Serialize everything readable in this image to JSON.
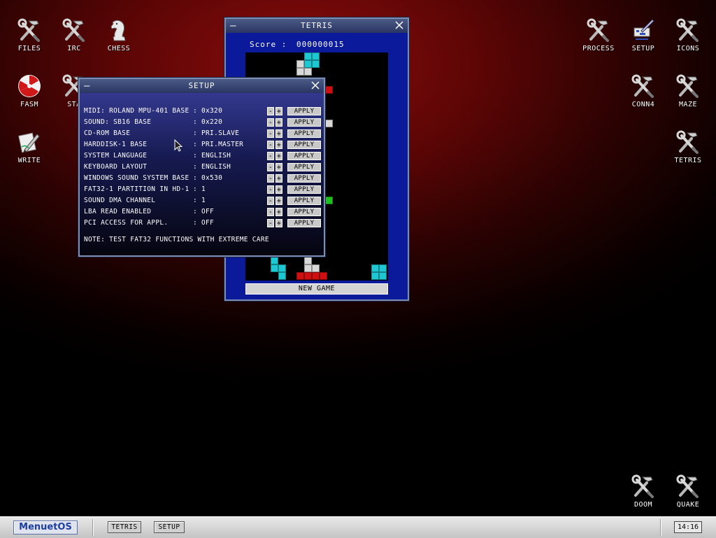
{
  "desktop": {
    "icons": [
      {
        "label": "FILES",
        "icon": "tools-icon"
      },
      {
        "label": "IRC",
        "icon": "tools-icon"
      },
      {
        "label": "CHESS",
        "icon": "chess-knight-icon"
      },
      {
        "label": "FASM",
        "icon": "radiation-icon"
      },
      {
        "label": "STA",
        "icon": "tools-icon"
      },
      {
        "label": "WRITE",
        "icon": "pen-icon"
      },
      {
        "label": "PROCESS",
        "icon": "tools-icon"
      },
      {
        "label": "SETUP",
        "icon": "setup-icon"
      },
      {
        "label": "ICONS",
        "icon": "tools-icon"
      },
      {
        "label": "CONN4",
        "icon": "tools-icon"
      },
      {
        "label": "MAZE",
        "icon": "tools-icon"
      },
      {
        "label": "TETRIS",
        "icon": "tools-icon"
      },
      {
        "label": "DOOM",
        "icon": "tools-icon"
      },
      {
        "label": "QUAKE",
        "icon": "tools-icon"
      }
    ]
  },
  "tetris": {
    "title": "TETRIS",
    "score_label": "Score :",
    "score_value": "000000015",
    "new_game": "NEW GAME"
  },
  "setup": {
    "title": "SETUP",
    "rows": [
      {
        "name": "MIDI: ROLAND MPU-401 BASE",
        "value": "0x320"
      },
      {
        "name": "SOUND: SB16 BASE",
        "value": "0x220"
      },
      {
        "name": "CD-ROM BASE",
        "value": "PRI.SLAVE"
      },
      {
        "name": "HARDDISK-1 BASE",
        "value": "PRI.MASTER"
      },
      {
        "name": "SYSTEM LANGUAGE",
        "value": "ENGLISH"
      },
      {
        "name": "KEYBOARD LAYOUT",
        "value": "ENGLISH"
      },
      {
        "name": "WINDOWS SOUND SYSTEM BASE",
        "value": "0x530"
      },
      {
        "name": "FAT32-1 PARTITION IN HD-1",
        "value": "1"
      },
      {
        "name": "SOUND DMA CHANNEL",
        "value": "1"
      },
      {
        "name": "LBA READ ENABLED",
        "value": "OFF"
      },
      {
        "name": "PCI ACCESS FOR APPL.",
        "value": "OFF"
      }
    ],
    "colon": ":",
    "minus": "-",
    "plus": "+",
    "apply": "APPLY",
    "note": "NOTE: TEST FAT32 FUNCTIONS WITH EXTREME CARE"
  },
  "taskbar": {
    "menu_label": "MenuetOS",
    "tasks": [
      "TETRIS",
      "SETUP"
    ],
    "clock": "14:16"
  },
  "colors": {
    "background_red": "#8a0c0c",
    "titlebar": "#2a3562",
    "tetris_bg": "#0a1a9a",
    "menu_text": "#1e3ea0"
  }
}
